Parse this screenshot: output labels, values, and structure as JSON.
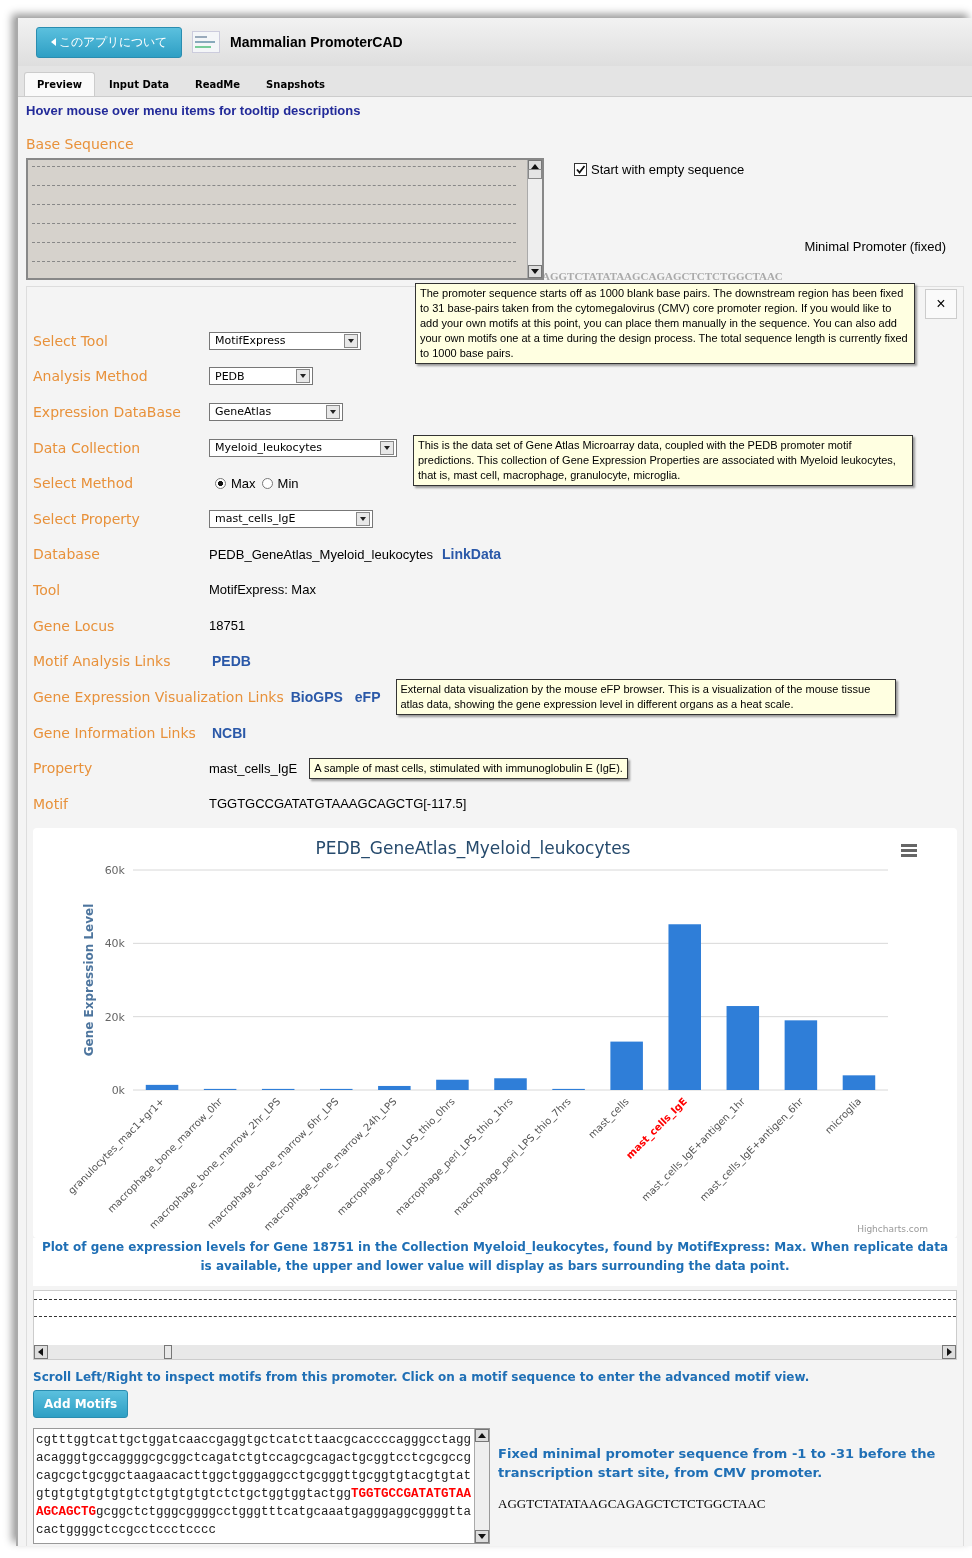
{
  "header": {
    "back_button": "このアプリについて",
    "title": "Mammalian PromoterCAD"
  },
  "tabs": [
    {
      "label": "Preview",
      "selected": true
    },
    {
      "label": "Input Data",
      "selected": false
    },
    {
      "label": "ReadMe",
      "selected": false
    },
    {
      "label": "Snapshots",
      "selected": false
    }
  ],
  "hint": "Hover mouse over menu items for tooltip descriptions",
  "base_sequence": {
    "label": "Base Sequence",
    "empty_start": {
      "label": "Start with empty sequence",
      "checked": true
    },
    "minimal_label": "Minimal Promoter (fixed)",
    "minimal_sequence": "AGGTCTATATAAGCAGAGCTCTCTGGCTAAC"
  },
  "tooltips": [
    {
      "text": "The promoter sequence starts off as 1000 blank base pairs. The downstream region has been fixed to 31 base-pairs taken from the cytomegalovirus (CMV) core promoter region. If you would like to add your own motifs at this point, you can place them manually in the sequence. You can also add your own motifs one at a time during the design process. The total sequence length is currently fixed to 1000 base pairs."
    },
    {
      "text": "This is the data set of Gene Atlas Microarray data, coupled with the PEDB promoter motif predictions. This collection of Gene Expression Properties are associated with Myeloid leukocytes, that is, mast cell, macrophage, granulocyte, microglia."
    }
  ],
  "close_button": "×",
  "form": [
    {
      "kind": "select",
      "label": "Select Tool",
      "value": "MotifExpress"
    },
    {
      "kind": "select",
      "label": "Analysis Method",
      "value": "PEDB"
    },
    {
      "kind": "select",
      "label": "Expression DataBase",
      "value": "GeneAtlas"
    },
    {
      "kind": "select",
      "label": "Data Collection",
      "value": "Myeloid_leukocytes"
    },
    {
      "kind": "radio",
      "label": "Select Method",
      "options": [
        {
          "label": "Max",
          "selected": true
        },
        {
          "label": "Min",
          "selected": false
        }
      ]
    },
    {
      "kind": "select",
      "label": "Select Property",
      "value": "mast_cells_IgE"
    },
    {
      "kind": "text",
      "label": "Database",
      "value": "PEDB_GeneAtlas_Myeloid_leukocytes",
      "links": [
        "LinkData"
      ]
    },
    {
      "kind": "text",
      "label": "Tool",
      "value": "MotifExpress: Max"
    },
    {
      "kind": "text",
      "label": "Gene Locus",
      "value": "18751"
    },
    {
      "kind": "text",
      "label": "Motif Analysis Links",
      "links": [
        "PEDB"
      ]
    },
    {
      "kind": "text",
      "label": "Gene Expression Visualization Links",
      "links": [
        "BioGPS",
        "eFP"
      ],
      "tooltip": "External data visualization by the mouse eFP browser. This is a visualization of the mouse tissue atlas data, showing the gene expression level in different organs as a heat scale."
    },
    {
      "kind": "text",
      "label": "Gene Information Links",
      "links": [
        "NCBI"
      ]
    },
    {
      "kind": "text",
      "label": "Property",
      "value": "mast_cells_IgE",
      "tooltip": "A sample of mast cells, stimulated with immunoglobulin E (IgE)."
    },
    {
      "kind": "text",
      "label": "Motif",
      "value": "TGGTGCCGATATGTAAAGCAGCTG[-117.5]"
    }
  ],
  "chart": {
    "credit": "Highcharts.com",
    "highlighted": [
      false,
      false,
      false,
      false,
      false,
      false,
      false,
      false,
      false,
      true,
      false,
      false,
      false
    ],
    "chart_data": {
      "type": "bar",
      "title": "PEDB_GeneAtlas_Myeloid_leukocytes",
      "ylabel": "Gene Expression Level",
      "categories": [
        "granulocytes_mac1+gr1+",
        "macrophage_bone_marrow_0hr",
        "macrophage_bone_marrow_2hr_LPS",
        "macrophage_bone_marrow_6hr_LPS",
        "macrophage_bone_marrow_24h_LPS",
        "macrophage_peri_LPS_thio_0hrs",
        "macrophage_peri_LPS_thio_1hrs",
        "macrophage_peri_LPS_thio_7hrs",
        "mast_cells",
        "mast_cells_IgE",
        "mast_cells_IgE+antigen_1hr",
        "mast_cells_IgE+antigen_6hr",
        "microglia"
      ],
      "series": [
        {
          "color": "#2f7ed8",
          "values": [
            1400,
            300,
            300,
            300,
            1100,
            2800,
            3200,
            300,
            13200,
            45200,
            22900,
            19000,
            4000
          ]
        }
      ],
      "ylim": [
        0,
        60000
      ],
      "yticks": [
        {
          "value": 0,
          "label": "0k"
        },
        {
          "value": 20000,
          "label": "20k"
        },
        {
          "value": 40000,
          "label": "40k"
        },
        {
          "value": 60000,
          "label": "60k"
        }
      ]
    }
  },
  "chart_caption": "Plot of gene expression levels for Gene 18751 in the Collection Myeloid_leukocytes, found by MotifExpress: Max. When replicate data is available, the upper and lower value will display as bars surrounding the data point.",
  "scroll_hint": "Scroll Left/Right to inspect motifs from this promoter. Click on a motif sequence to enter the advanced motif view.",
  "add_motifs_button": "Add Motifs",
  "sequence_lines": [
    "cgtttggtcattgctggatcaaccgaggtgctcatcttaacgcaccccagggcctagg",
    "acagggtgccaggggcgcggctcagatctgtccagcgcagactgcggtcctcgcgccg",
    "cagcgctgcggctaagaacacttggctgggaggcctgcgggttgcggtgtacgtgtat",
    "gtgtgtgtgtgtgtctgtgtgtgtctctgctggtggtactgg**TGGTGCCGATATGTAA**",
    "**AGCAGCTG**gcggctctgggcggggcctgggtttcatgcaaatgagggaggcggggtta",
    "cactggggctccgcctccctcccc"
  ],
  "fixed_note": "Fixed minimal promoter sequence from -1 to -31 before the transcription start site, from CMV promoter.",
  "fixed_sequence": "AGGTCTATATAAGCAGAGCTCTCTGGCTAAC"
}
